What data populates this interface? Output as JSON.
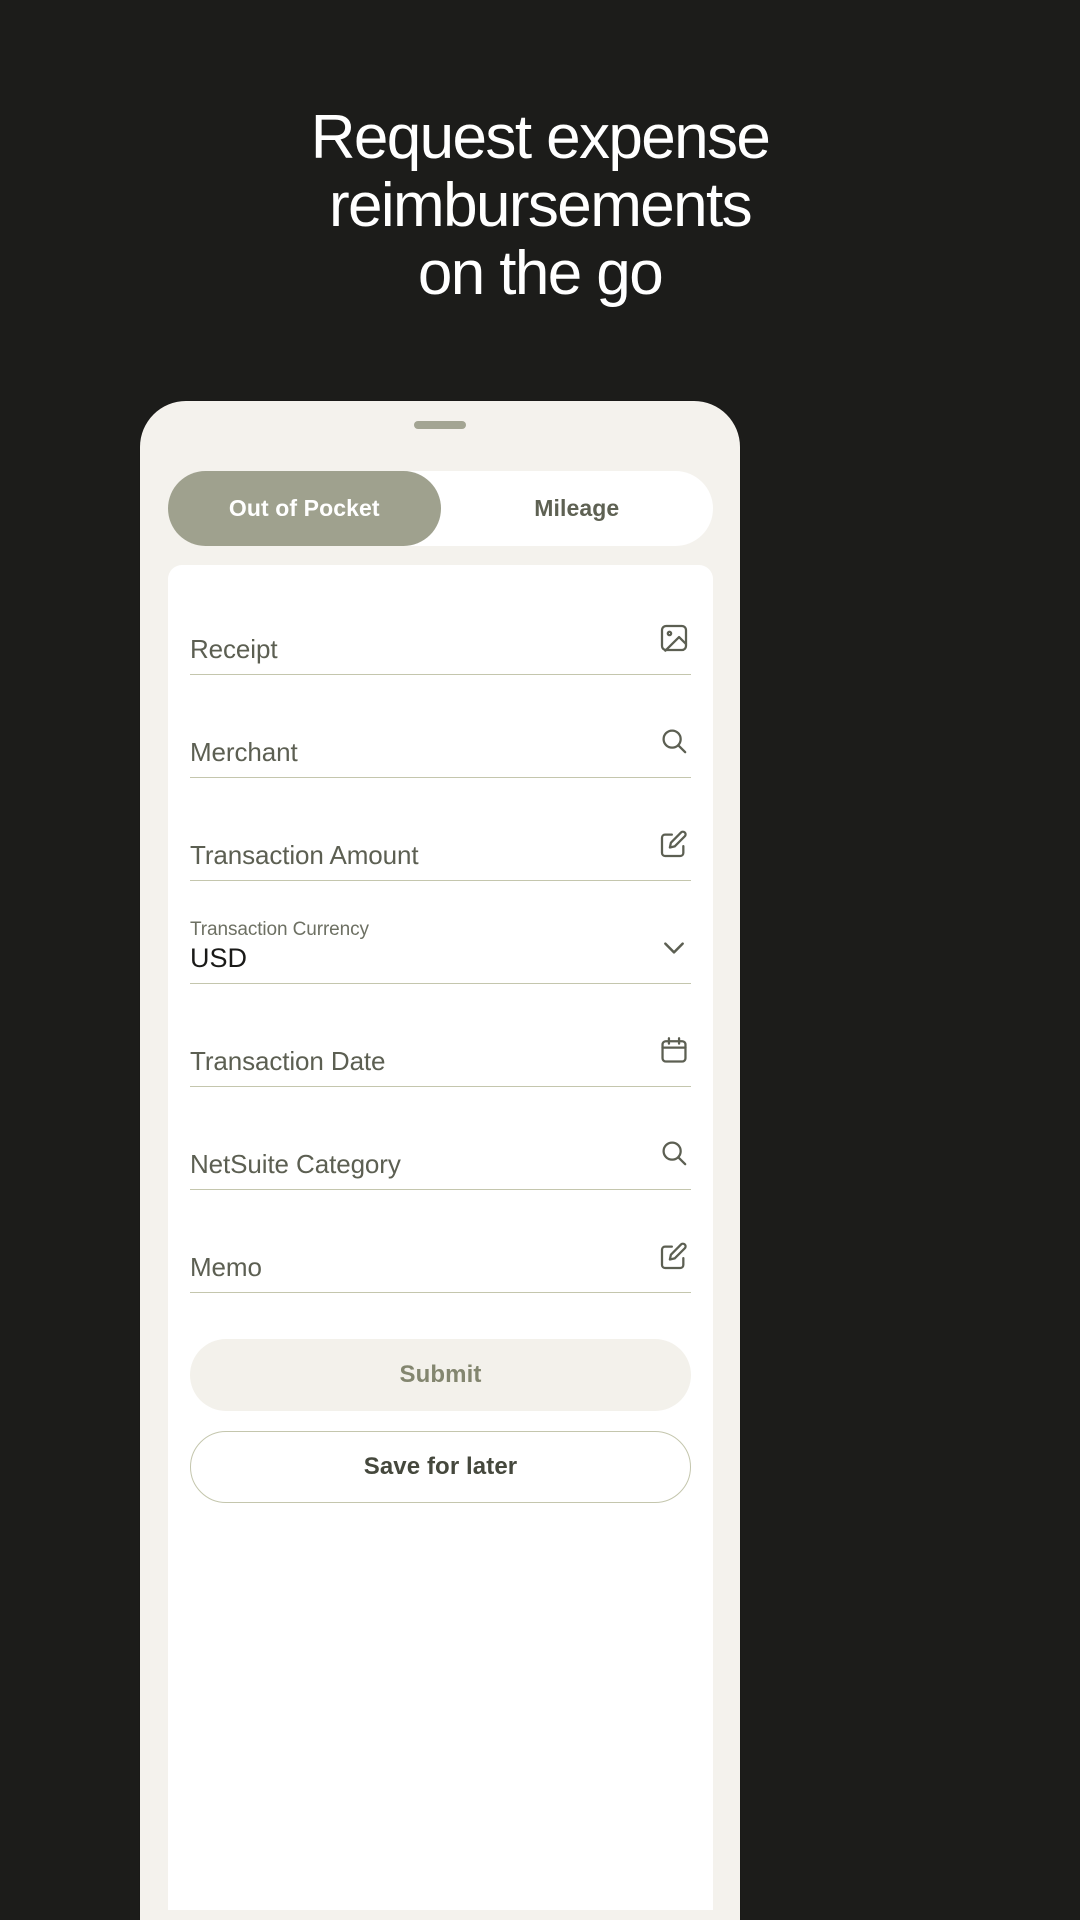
{
  "headline": {
    "lines": [
      "Request expense",
      "reimbursements",
      "on the go"
    ]
  },
  "colors": {
    "background": "#1c1c1a",
    "phone_frame": "#f4f2ed",
    "accent": "#9fa18e",
    "field_underline": "#c4c6ad",
    "label_text": "#5c5f52",
    "submit_fill": "#f3f1eb"
  },
  "phone": {
    "drag_handle": "drag-handle"
  },
  "tabs": [
    {
      "label": "Out of Pocket",
      "active": true
    },
    {
      "label": "Mileage",
      "active": false
    }
  ],
  "form": {
    "fields": [
      {
        "label": "Receipt",
        "value": "",
        "icon": "image-icon"
      },
      {
        "label": "Merchant",
        "value": "",
        "icon": "search-icon"
      },
      {
        "label": "Transaction Amount",
        "value": "",
        "icon": "edit-icon"
      },
      {
        "label": "Transaction Currency",
        "value": "USD",
        "icon": "chevron-down-icon"
      },
      {
        "label": "Transaction Date",
        "value": "",
        "icon": "calendar-icon"
      },
      {
        "label": "NetSuite Category",
        "value": "",
        "icon": "search-icon"
      },
      {
        "label": "Memo",
        "value": "",
        "icon": "edit-icon"
      }
    ]
  },
  "actions": {
    "submit_label": "Submit",
    "save_label": "Save for later"
  }
}
